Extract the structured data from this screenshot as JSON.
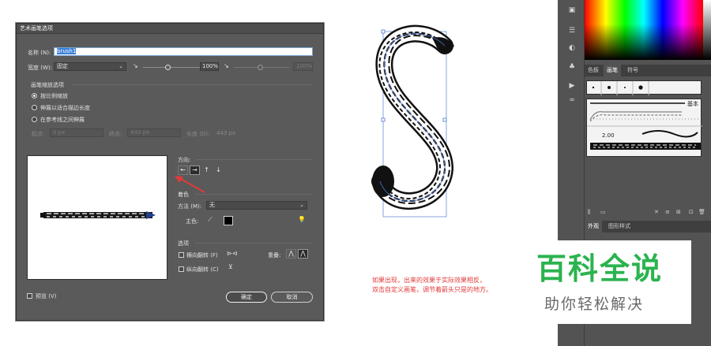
{
  "dialog": {
    "title": "艺术画笔选项",
    "name_label": "名称 (N):",
    "name_value": "brush1",
    "width_label": "宽度 (W):",
    "width_value": "固定",
    "width_percent": "100%",
    "width_percent_dim": "100%",
    "scale_group_label": "画笔缩放选项",
    "scale_options": [
      "按比例缩放",
      "伸展以适合描边长度",
      "在参考线之间伸展"
    ],
    "scale_selected": 0,
    "start_label": "起点:",
    "start_value": "0 px",
    "end_label": "终点:",
    "end_value": "443 px",
    "length_label": "长度 (D):",
    "length_value": "443 px",
    "direction_label": "方向:",
    "direction_buttons": [
      "←",
      "→",
      "↑",
      "↓"
    ],
    "direction_selected": 1,
    "colorize_label": "着色",
    "method_label": "方法 (M):",
    "method_value": "无",
    "key_color_label": "主色:",
    "key_color": "#000000",
    "options_label": "选项",
    "flip_h_label": "横向翻转 (F)",
    "flip_v_label": "纵向翻转 (C)",
    "overlap_label": "重叠:",
    "preview_label": "预览 (V)",
    "ok_label": "确定",
    "cancel_label": "取消"
  },
  "annotation": {
    "line1": "如果出现，出来的效果于实际效果相反，",
    "line2": "双击自定义画笔，调节着箭头只是的地方。"
  },
  "watermark": {
    "main": "百科全说",
    "sub": "助你轻松解决"
  },
  "brushes_panel": {
    "tabs": [
      "色板",
      "画笔",
      "符号"
    ],
    "active_tab": 1,
    "basic_label": "基本",
    "stroke_value": "2.00"
  },
  "appearance_panel": {
    "tabs": [
      "外观",
      "图形样式"
    ],
    "active_tab": 0
  },
  "colors": {
    "accent_red": "#e23a3a",
    "watermark_green": "#2bb34f",
    "selection_blue": "#3b7fd9"
  }
}
